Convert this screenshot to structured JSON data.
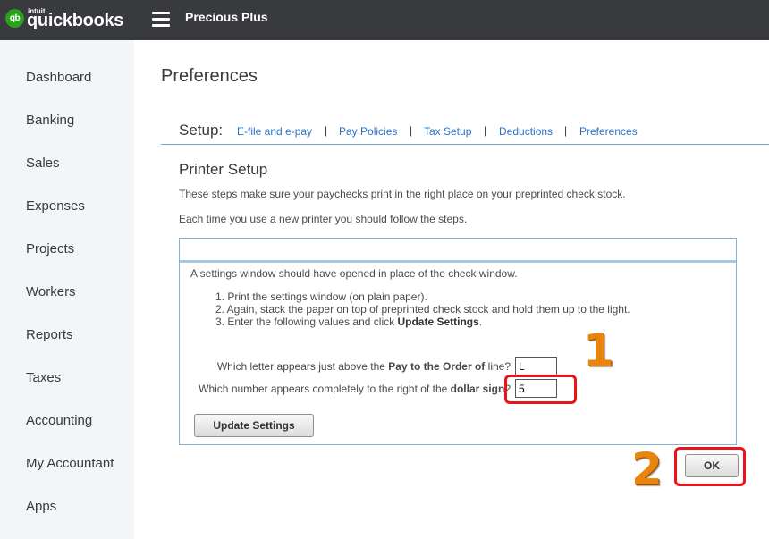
{
  "header": {
    "logo_mark": "qb",
    "logo_intuit": "intuit",
    "logo_text": "quickbooks",
    "company_name": "Precious Plus"
  },
  "sidebar": {
    "items": [
      {
        "label": "Dashboard"
      },
      {
        "label": "Banking"
      },
      {
        "label": "Sales"
      },
      {
        "label": "Expenses"
      },
      {
        "label": "Projects"
      },
      {
        "label": "Workers"
      },
      {
        "label": "Reports"
      },
      {
        "label": "Taxes"
      },
      {
        "label": "Accounting"
      },
      {
        "label": "My Accountant"
      },
      {
        "label": "Apps"
      }
    ]
  },
  "page": {
    "title": "Preferences"
  },
  "setup": {
    "label": "Setup:",
    "separator": "|",
    "links": [
      {
        "label": "E-file and e-pay"
      },
      {
        "label": "Pay Policies"
      },
      {
        "label": "Tax Setup"
      },
      {
        "label": "Deductions"
      },
      {
        "label": "Preferences"
      }
    ]
  },
  "printer_setup": {
    "title": "Printer Setup",
    "intro1": "These steps make sure your paychecks print in the right place on your preprinted check stock.",
    "intro2": "Each time you use a new printer you should follow the steps.",
    "panel": {
      "lead": "A settings window should have opened in place of the check window.",
      "step1": "1. Print the settings window (on plain paper).",
      "step2": "2. Again, stack the paper on top of preprinted check stock and hold them up to the light.",
      "step3_prefix": "3. Enter the following values and click ",
      "step3_bold": "Update Settings",
      "step3_suffix": ".",
      "q1_prefix": "Which letter appears just above the ",
      "q1_bold": "Pay to the Order of",
      "q1_suffix": " line?",
      "q1_value": "L",
      "q2_prefix": "Which number appears completely to the right of the ",
      "q2_bold": "dollar sign",
      "q2_suffix": "?",
      "q2_value": "5",
      "update_button": "Update Settings"
    },
    "ok_button": "OK"
  },
  "annotations": {
    "step1_label": "1",
    "step2_label": "2",
    "highlight_color": "#e8141a",
    "number_color": "#e8850f"
  }
}
